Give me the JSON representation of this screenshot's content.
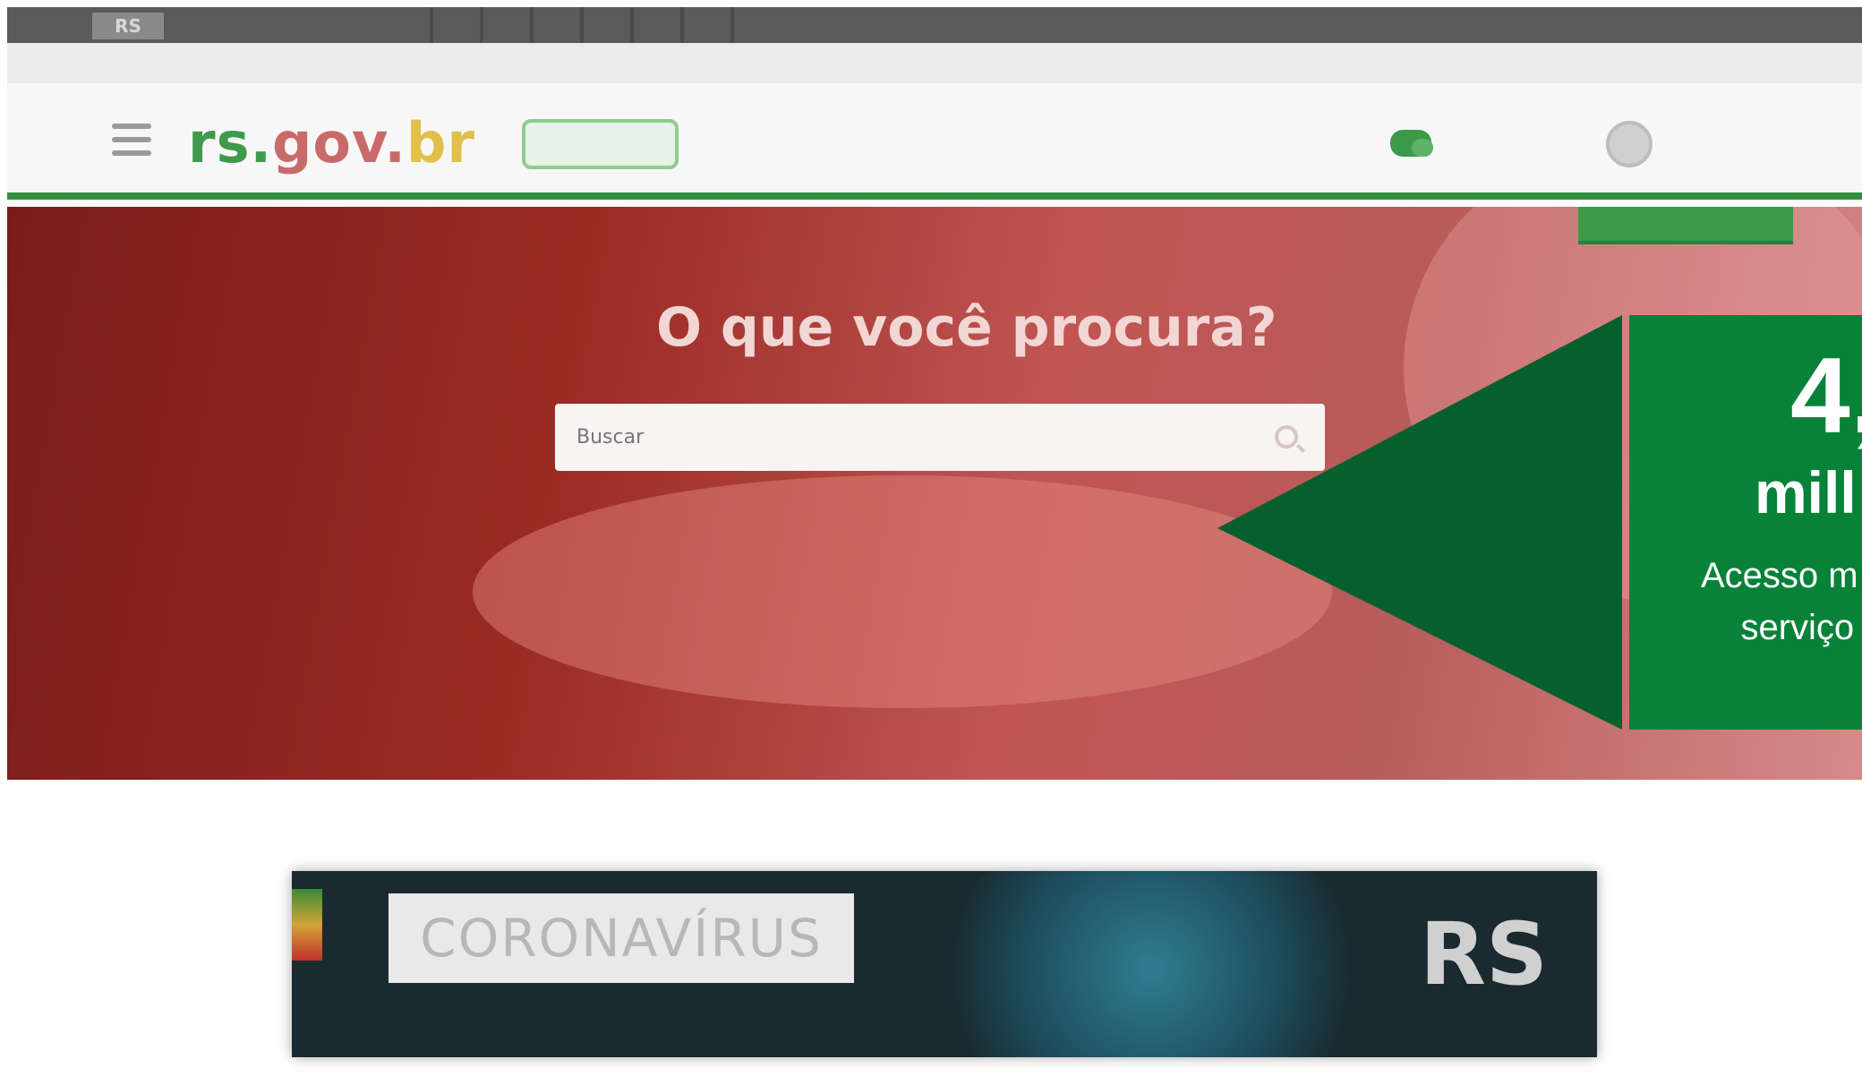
{
  "gov_bar": {
    "logo": "RS",
    "links": [
      "",
      "",
      "",
      "",
      "",
      "",
      ""
    ]
  },
  "utility_bar": {
    "left_links": [
      "",
      "",
      "",
      ""
    ],
    "right_links": [
      "",
      ""
    ]
  },
  "header": {
    "brand_part1": "rs.",
    "brand_part2": "gov.",
    "brand_part3": "br",
    "badge": "",
    "chat_label": "",
    "user_label": ""
  },
  "hero": {
    "ribbon": "",
    "title": "O que você procura?",
    "search_placeholder": "Buscar",
    "quick_links": [
      "",
      "",
      ""
    ]
  },
  "banner": {
    "headline": "CORONAVÍRUS",
    "subtitle": "",
    "brand": "RS"
  },
  "callout": {
    "number": "4,",
    "unit": "mill",
    "text_line1": "Acesso m",
    "text_line2": "serviço"
  },
  "colors": {
    "callout_green": "#078238",
    "callout_dark_green": "#06602e",
    "brand_green": "#3e9a4c",
    "hero_red": "#9a2a24"
  }
}
